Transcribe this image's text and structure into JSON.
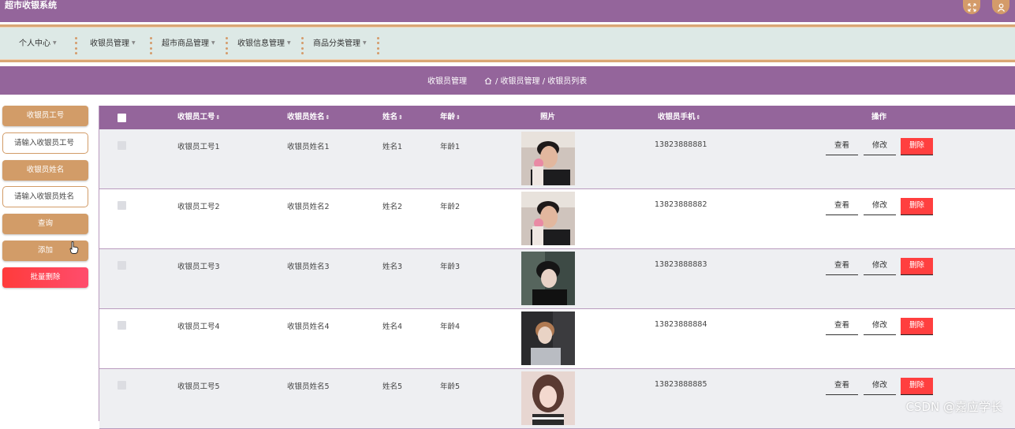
{
  "app": {
    "title": "超市收银系统"
  },
  "header": {
    "fullscreen_icon": "expand-icon",
    "user_icon": "user-icon"
  },
  "nav": {
    "items": [
      {
        "label": "个人中心"
      },
      {
        "label": "收银员管理"
      },
      {
        "label": "超市商品管理"
      },
      {
        "label": "收银信息管理"
      },
      {
        "label": "商品分类管理"
      }
    ]
  },
  "breadcrumb": {
    "title": "收银员管理",
    "home_icon": "home-icon",
    "path": "/ 收银员管理 / 收银员列表"
  },
  "search": {
    "id_label": "收银员工号",
    "id_placeholder": "请输入收银员工号",
    "name_label": "收银员姓名",
    "name_placeholder": "请输入收银员姓名",
    "query_button": "查询",
    "add_button": "添加",
    "batch_delete_button": "批量删除"
  },
  "table": {
    "columns": [
      {
        "label": "收银员工号",
        "sortable": true
      },
      {
        "label": "收银员姓名",
        "sortable": true
      },
      {
        "label": "姓名",
        "sortable": true
      },
      {
        "label": "年龄",
        "sortable": true
      },
      {
        "label": "照片",
        "sortable": false
      },
      {
        "label": "收银员手机",
        "sortable": true
      },
      {
        "label": "操作",
        "sortable": false
      }
    ],
    "sort_icon": "sort-icon",
    "rows": [
      {
        "id": "收银员工号1",
        "cashier_name": "收银员姓名1",
        "name": "姓名1",
        "age": "年龄1",
        "phone": "13823888881"
      },
      {
        "id": "收银员工号2",
        "cashier_name": "收银员姓名2",
        "name": "姓名2",
        "age": "年龄2",
        "phone": "13823888882"
      },
      {
        "id": "收银员工号3",
        "cashier_name": "收银员姓名3",
        "name": "姓名3",
        "age": "年龄3",
        "phone": "13823888883"
      },
      {
        "id": "收银员工号4",
        "cashier_name": "收银员姓名4",
        "name": "姓名4",
        "age": "年龄4",
        "phone": "13823888884"
      },
      {
        "id": "收银员工号5",
        "cashier_name": "收银员姓名5",
        "name": "姓名5",
        "age": "年龄5",
        "phone": "13823888885"
      }
    ],
    "actions": {
      "view": "查看",
      "edit": "修改",
      "delete": "删除"
    }
  },
  "watermark": "CSDN @嘉应学长",
  "colors": {
    "primary_purple": "#94659b",
    "accent_tan": "#d29c68",
    "danger_red": "#ff3f3f",
    "nav_bg": "#dde9e6"
  }
}
